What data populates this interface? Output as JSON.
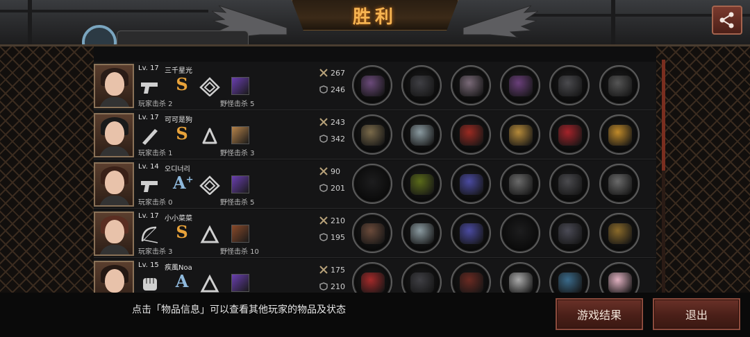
{
  "header": {
    "title": "胜利"
  },
  "rows": [
    {
      "level": "Lv. 17",
      "name": "三千星光",
      "rank": "S",
      "rank_plus": "",
      "player_kills": "玩家击杀 2",
      "monster_kills": "野怪击杀 5",
      "attack": "267",
      "defense": "246",
      "weapon": "pistol-icon",
      "hair": "#2a1c17"
    },
    {
      "level": "Lv. 17",
      "name": "可可是狗",
      "rank": "S",
      "rank_plus": "",
      "player_kills": "玩家击杀 1",
      "monster_kills": "野怪击杀 3",
      "attack": "243",
      "defense": "342",
      "weapon": "bat-icon",
      "hair": "#1a1a1a"
    },
    {
      "level": "Lv. 14",
      "name": "오디너리",
      "rank": "A",
      "rank_plus": "+",
      "player_kills": "玩家击杀 0",
      "monster_kills": "野怪击杀 5",
      "attack": "90",
      "defense": "201",
      "weapon": "pistol-icon",
      "hair": "#3a2118"
    },
    {
      "level": "Lv. 17",
      "name": "小小菜菜",
      "rank": "S",
      "rank_plus": "",
      "player_kills": "玩家击杀 3",
      "monster_kills": "野怪击杀 10",
      "attack": "210",
      "defense": "195",
      "weapon": "bow-icon",
      "hair": "#5a2e22"
    },
    {
      "level": "Lv. 15",
      "name": "疾風Noa",
      "rank": "A",
      "rank_plus": "",
      "player_kills": "",
      "monster_kills": "",
      "attack": "175",
      "defense": "210",
      "weapon": "fist-icon",
      "hair": "#241813"
    }
  ],
  "bottom": {
    "hint": "点击「物品信息」可以查看其他玩家的物品及状态",
    "results_label": "游戏结果",
    "exit_label": "退出"
  },
  "colors": {
    "accent": "#f7b451",
    "button": "#6a3128",
    "rank_s": "#e9a33a",
    "rank_a": "#8fb9dc"
  }
}
